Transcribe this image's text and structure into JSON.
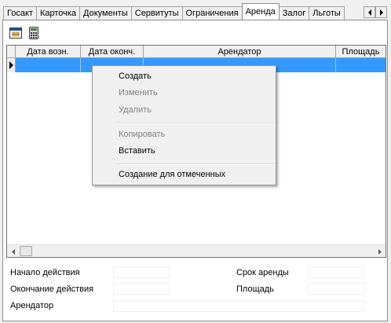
{
  "tabs": [
    "Госакт",
    "Карточка",
    "Документы",
    "Сервитуты",
    "Ограничения",
    "Аренда",
    "Залог",
    "Льготы"
  ],
  "active_tab": "Аренда",
  "toolbar": {
    "icons": [
      "grid-view-icon",
      "calculator-icon"
    ]
  },
  "grid": {
    "columns": [
      "Дата возн.",
      "Дата оконч.",
      "Арендатор",
      "Площадь"
    ],
    "selected_row": 1
  },
  "context_menu": {
    "items": [
      {
        "label": "Создать",
        "enabled": true
      },
      {
        "label": "Изменить",
        "enabled": false
      },
      {
        "label": "Удалить",
        "enabled": false
      },
      {
        "label": "Копировать",
        "enabled": false
      },
      {
        "label": "Вставить",
        "enabled": true
      },
      {
        "label": "Создание для отмеченных",
        "enabled": true
      }
    ]
  },
  "form": {
    "start_label": "Начало действия",
    "end_label": "Окончание действия",
    "tenant_label": "Арендатор",
    "term_label": "Срок аренды",
    "area_label": "Площадь",
    "start_value": "",
    "end_value": "",
    "tenant_value": "",
    "term_value": "",
    "area_value": ""
  }
}
